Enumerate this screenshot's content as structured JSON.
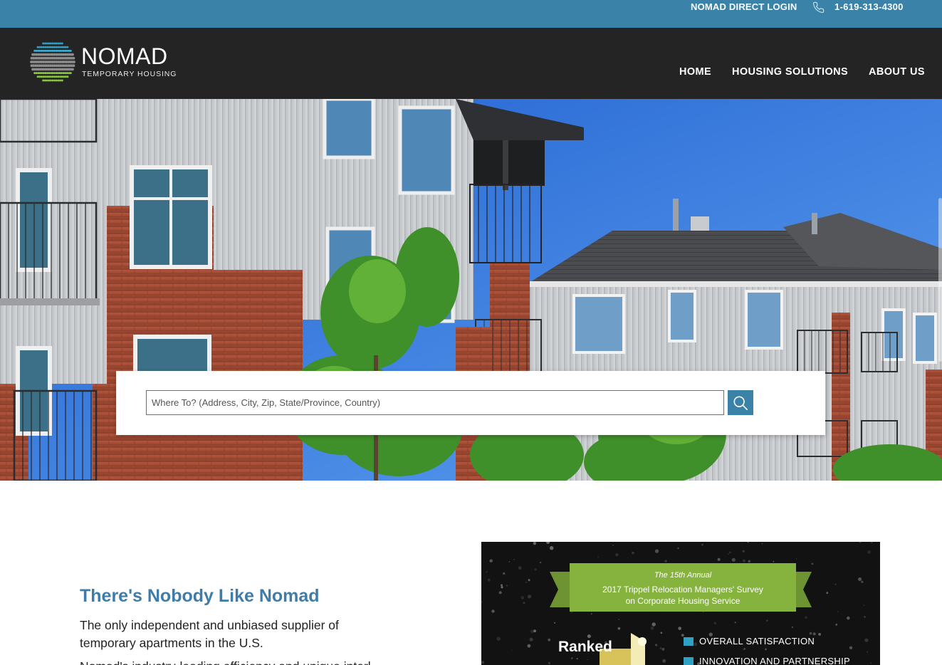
{
  "utility": {
    "login_label": "NOMAD DIRECT LOGIN",
    "phone": "1-619-313-4300",
    "phone_icon": "phone-icon"
  },
  "header": {
    "logo_word": "NOMAD",
    "logo_tag": "TEMPORARY HOUSING",
    "nav": {
      "home": "HOME",
      "housing": "HOUSING SOLUTIONS",
      "about": "ABOUT US"
    }
  },
  "search": {
    "placeholder": "Where To? (Address, City, Zip, State/Province, Country)",
    "value": "",
    "button_icon": "search-icon"
  },
  "intro": {
    "heading": "There's Nobody Like Nomad",
    "lead": "The only independent and unbiased supplier of temporary apartments in the U.S.",
    "more": "Nomad's industry-leading efficiency and unique interl..."
  },
  "award": {
    "line1": "The 15th Annual",
    "line2": "2017 Trippel Relocation Managers' Survey",
    "line3": "on Corporate Housing Service",
    "ranked": "Ranked",
    "items": [
      "OVERALL SATISFACTION",
      "INNOVATION AND PARTNERSHIP"
    ]
  },
  "colors": {
    "utility_bar": "#3a82a8",
    "header_bg": "#242424",
    "accent": "#3a82a8",
    "heading": "#3f7da8",
    "award_green": "#86b33e"
  }
}
